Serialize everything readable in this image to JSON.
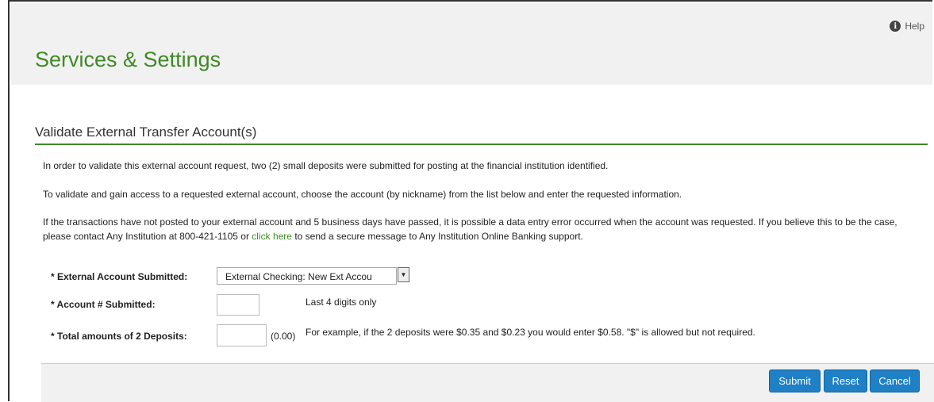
{
  "help": {
    "label": "Help",
    "icon": "info-icon"
  },
  "page_title": "Services & Settings",
  "section": {
    "title": "Validate External Transfer Account(s)",
    "para1": "In order to validate this external account request, two (2) small deposits were submitted for posting at the financial institution identified.",
    "para2": "To validate and gain access to a requested external account, choose the account (by nickname) from the list below and enter the requested information.",
    "para3_before": "If the transactions have not posted to your external account and 5 business days have passed, it is possible a data entry error occurred when the account was requested. If you believe this to be the case, please contact Any Institution at 800-421-1105 or ",
    "para3_link": "click here",
    "para3_after": " to send a secure message to Any Institution Online Banking support."
  },
  "form": {
    "external_account_label": "* External Account Submitted:",
    "external_account_value": "External Checking: New Ext Accou",
    "account_number_label": "* Account # Submitted:",
    "account_number_hint": "Last 4 digits only",
    "deposits_label": "* Total amounts of 2 Deposits:",
    "deposits_suffix": "(0.00)",
    "deposits_hint": "For example, if the 2 deposits were $0.35 and $0.23 you would enter $0.58. \"$\" is allowed but not required."
  },
  "buttons": {
    "submit": "Submit",
    "reset": "Reset",
    "cancel": "Cancel"
  },
  "colors": {
    "accent_green": "#3f8a25",
    "button_blue": "#1f80c5"
  }
}
